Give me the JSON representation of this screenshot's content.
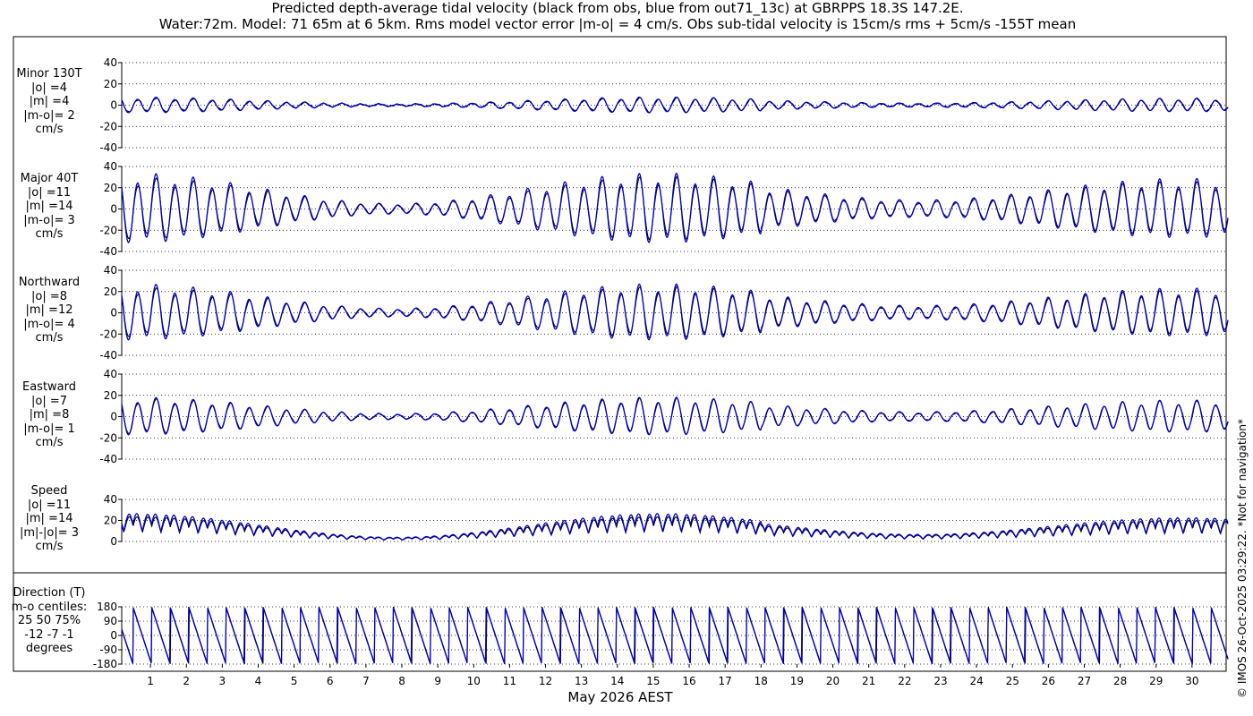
{
  "title": {
    "line1": "Predicted depth-average tidal velocity (black from obs, blue from out71_13c) at GBRPPS 18.3S 147.2E.",
    "line2": "Water:72m. Model: 71 65m at 6 5km. Rms model vector error |m-o| = 4 cm/s. Obs sub-tidal velocity is 15cm/s rms + 5cm/s -155T mean"
  },
  "credit": "© IMOS 26-Oct-2025 03:29:22. *Not for navigation*",
  "xlabel": "May 2026 AEST",
  "colors": {
    "obs": "#000000",
    "model": "#0000cc",
    "grid": "#000000"
  },
  "chart_data": {
    "type": "line",
    "x_unit": "day of May 2026",
    "xlim": [
      0.2,
      31.0
    ],
    "x_ticks": [
      1,
      2,
      3,
      4,
      5,
      6,
      7,
      8,
      9,
      10,
      11,
      12,
      13,
      14,
      15,
      16,
      17,
      18,
      19,
      20,
      21,
      22,
      23,
      24,
      25,
      26,
      27,
      28,
      29,
      30
    ],
    "series_style": {
      "obs": "black line (from obs)",
      "model": "blue line (from out71_13c)"
    },
    "panels": [
      {
        "id": "minor",
        "label": [
          "Minor 130T",
          "|o| =4",
          "|m| =4",
          "|m-o|= 2",
          "cm/s"
        ],
        "ylim": [
          -40,
          40
        ],
        "yticks": [
          -40,
          -20,
          0,
          20,
          40
        ],
        "ytick_labels": [
          "-40",
          "-20",
          "0",
          "20",
          "40"
        ],
        "kind": "component",
        "amp": 6,
        "ratio": 1.1,
        "bias": 0
      },
      {
        "id": "major",
        "label": [
          "Major 40T",
          "|o| =11",
          "|m| =14",
          "|m-o|= 3",
          "cm/s"
        ],
        "ylim": [
          -40,
          40
        ],
        "yticks": [
          -40,
          -20,
          0,
          20,
          40
        ],
        "ytick_labels": [
          "-40",
          "-20",
          "0",
          "20",
          "40"
        ],
        "kind": "component",
        "amp": 26,
        "ratio": 1.12,
        "bias": 0
      },
      {
        "id": "northward",
        "label": [
          "Northward",
          "|o| =8",
          "|m| =12",
          "|m-o|= 4",
          "cm/s"
        ],
        "ylim": [
          -40,
          40
        ],
        "yticks": [
          -40,
          -20,
          0,
          20,
          40
        ],
        "ytick_labels": [
          "-40",
          "-20",
          "0",
          "20",
          "40"
        ],
        "kind": "component",
        "amp": 21,
        "ratio": 1.12,
        "bias": 0
      },
      {
        "id": "eastward",
        "label": [
          "Eastward",
          "|o| =7",
          "|m| =8",
          "|m-o|= 1",
          "cm/s"
        ],
        "ylim": [
          -40,
          40
        ],
        "yticks": [
          -40,
          -20,
          0,
          20,
          40
        ],
        "ytick_labels": [
          "-40",
          "-20",
          "0",
          "20",
          "40"
        ],
        "kind": "component",
        "amp": 15,
        "ratio": 1.05,
        "bias": 0
      },
      {
        "id": "speed",
        "label": [
          "Speed",
          "|o| =11",
          "|m| =14",
          "|m|-|o|= 3",
          "cm/s"
        ],
        "ylim": [
          0,
          40
        ],
        "yticks": [
          0,
          20,
          40
        ],
        "ytick_labels": [
          "0",
          "20",
          "40"
        ],
        "kind": "speed",
        "amp": 26,
        "ratio": 1.12,
        "bias": 0
      },
      {
        "id": "direction",
        "label": [
          "Direction (T)",
          "m-o centiles:",
          "25  50  75%",
          "-12  -7  -1",
          "degrees"
        ],
        "ylim": [
          -180,
          180
        ],
        "yticks": [
          -180,
          -90,
          0,
          90,
          180
        ],
        "ytick_labels": [
          "-180",
          "-90",
          "0",
          "90",
          "180"
        ],
        "kind": "direction",
        "amp": 180,
        "ratio": 1.0,
        "bias": 0
      }
    ],
    "tide_model": {
      "period_hours": 12.42,
      "spring_days": [
        0.5,
        15.2,
        29.8
      ],
      "neap_days": [
        7.5,
        23.0
      ],
      "spring_factor": 1.0,
      "neap_factor": 0.15,
      "neap_factor_2": 0.55
    }
  }
}
